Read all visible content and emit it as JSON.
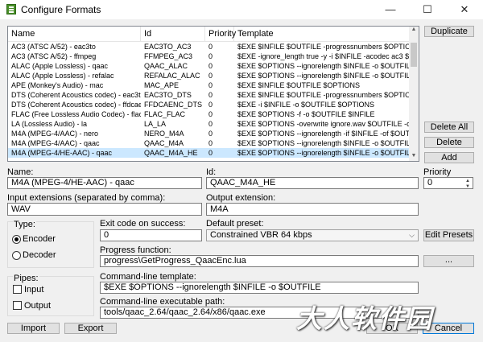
{
  "window": {
    "title": "Configure Formats",
    "minimize_icon": "—",
    "maximize_icon": "☐",
    "close_icon": "✕"
  },
  "formats_table": {
    "columns": [
      "Name",
      "Id",
      "Priority",
      "Template"
    ],
    "rows": [
      {
        "name": "AC3 (ATSC A/52) - eac3to",
        "id": "EAC3TO_AC3",
        "priority": "0",
        "template": "$EXE $INFILE $OUTFILE -progressnumbers $OPTIONS"
      },
      {
        "name": "AC3 (ATSC A/52) - ffmpeg",
        "id": "FFMPEG_AC3",
        "priority": "0",
        "template": "$EXE -ignore_length true -y -i $INFILE -acodec ac3 $OPTI"
      },
      {
        "name": "ALAC (Apple Lossless) - qaac",
        "id": "QAAC_ALAC",
        "priority": "0",
        "template": "$EXE $OPTIONS --ignorelength $INFILE -o $OUTFILE"
      },
      {
        "name": "ALAC (Apple Lossless) - refalac",
        "id": "REFALAC_ALAC",
        "priority": "0",
        "template": "$EXE $OPTIONS --ignorelength $INFILE -o $OUTFILE"
      },
      {
        "name": "APE (Monkey's Audio) - mac",
        "id": "MAC_APE",
        "priority": "0",
        "template": "$EXE $INFILE $OUTFILE $OPTIONS"
      },
      {
        "name": "DTS (Coherent Acoustics codec) - eac3to",
        "id": "EAC3TO_DTS",
        "priority": "0",
        "template": "$EXE $INFILE $OUTFILE -progressnumbers $OPTIONS"
      },
      {
        "name": "DTS (Coherent Acoustics codec) - ffdcaenc",
        "id": "FFDCAENC_DTS",
        "priority": "0",
        "template": "$EXE -i $INFILE -o $OUTFILE $OPTIONS"
      },
      {
        "name": "FLAC (Free Lossless Audio Codec) - flac",
        "id": "FLAC_FLAC",
        "priority": "0",
        "template": "$EXE $OPTIONS -f -o $OUTFILE $INFILE"
      },
      {
        "name": "LA (Lossless Audio) - la",
        "id": "LA_LA",
        "priority": "0",
        "template": "$EXE $OPTIONS -overwrite ignore.wav $OUTFILE -cin"
      },
      {
        "name": "M4A (MPEG-4/AAC) - nero",
        "id": "NERO_M4A",
        "priority": "0",
        "template": "$EXE $OPTIONS --ignorelength -if $INFILE -of $OUTFILE"
      },
      {
        "name": "M4A (MPEG-4/AAC) - qaac",
        "id": "QAAC_M4A",
        "priority": "0",
        "template": "$EXE $OPTIONS --ignorelength $INFILE -o $OUTFILE"
      },
      {
        "name": "M4A (MPEG-4/HE-AAC) - qaac",
        "id": "QAAC_M4A_HE",
        "priority": "0",
        "template": "$EXE $OPTIONS --ignorelength $INFILE -o $OUTFILE"
      }
    ],
    "selected_index": 11
  },
  "buttons": {
    "duplicate": "Duplicate",
    "delete_all": "Delete All",
    "delete": "Delete",
    "add": "Add",
    "edit_presets": "Edit Presets",
    "browse": "...",
    "import": "Import",
    "export": "Export",
    "ok": "OK",
    "cancel": "Cancel"
  },
  "form": {
    "name_label": "Name:",
    "name_value": "M4A (MPEG-4/HE-AAC) - qaac",
    "id_label": "Id:",
    "id_value": "QAAC_M4A_HE",
    "priority_label": "Priority",
    "priority_value": "0",
    "input_ext_label": "Input extensions (separated by comma):",
    "input_ext_value": "WAV",
    "output_ext_label": "Output extension:",
    "output_ext_value": "M4A",
    "type_label": "Type:",
    "encoder_label": "Encoder",
    "decoder_label": "Decoder",
    "exit_code_label": "Exit code on success:",
    "exit_code_value": "0",
    "default_preset_label": "Default preset:",
    "default_preset_value": "Constrained VBR 64 kbps",
    "progress_label": "Progress function:",
    "progress_value": "progress\\GetProgress_QaacEnc.lua",
    "pipes_label": "Pipes:",
    "input_pipe_label": "Input",
    "output_pipe_label": "Output",
    "cmd_template_label": "Command-line template:",
    "cmd_template_value": "$EXE $OPTIONS --ignorelength $INFILE -o $OUTFILE",
    "cmd_exe_label": "Command-line executable path:",
    "cmd_exe_value": "tools/qaac_2.64/qaac_2.64/x86/qaac.exe"
  },
  "watermark": "大人软件园"
}
